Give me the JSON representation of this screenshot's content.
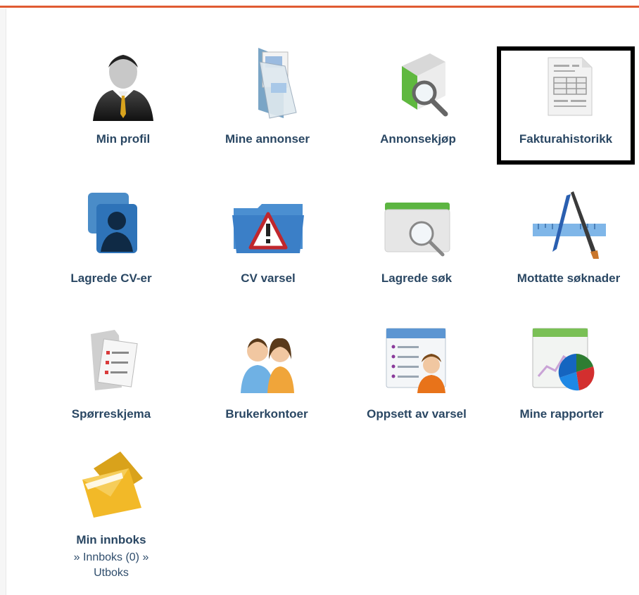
{
  "tiles": [
    {
      "label": "Min profil",
      "icon": "user-silhouette-icon"
    },
    {
      "label": "Mine annonser",
      "icon": "folder-documents-icon"
    },
    {
      "label": "Annonsekjøp",
      "icon": "magnify-box-icon"
    },
    {
      "label": "Fakturahistorikk",
      "icon": "invoice-document-icon"
    },
    {
      "label": "Lagrede CV-er",
      "icon": "contact-cards-icon"
    },
    {
      "label": "CV varsel",
      "icon": "warning-folder-icon"
    },
    {
      "label": "Lagrede søk",
      "icon": "search-tray-icon"
    },
    {
      "label": "Mottatte søknader",
      "icon": "ruler-pen-brush-icon"
    },
    {
      "label": "Spørreskjema",
      "icon": "checklist-folder-icon"
    },
    {
      "label": "Brukerkontoer",
      "icon": "two-users-icon"
    },
    {
      "label": "Oppsett av varsel",
      "icon": "person-list-icon"
    },
    {
      "label": "Mine rapporter",
      "icon": "pie-chart-report-icon"
    },
    {
      "label": "Min innboks",
      "icon": "envelope-icon"
    }
  ],
  "inbox_links": {
    "sep": "»",
    "innboks": "Innboks (0)",
    "utboks": "Utboks"
  },
  "colors": {
    "accent_rule": "#e05b32",
    "label": "#2a4763",
    "highlight_border": "#000000"
  }
}
